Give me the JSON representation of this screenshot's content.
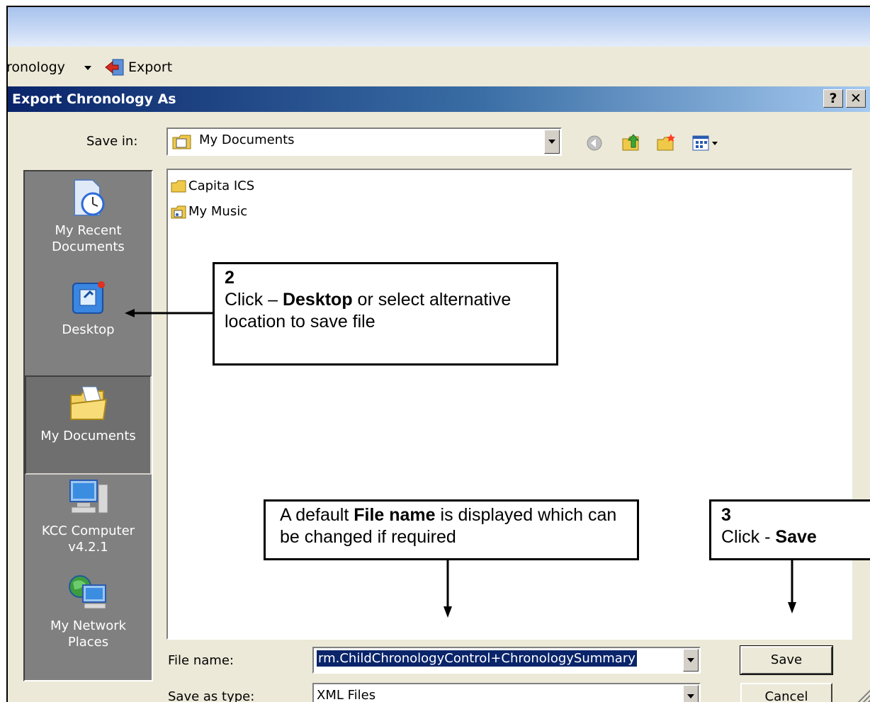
{
  "toolbar": {
    "crumb_text": "ronology",
    "export_label": "Export"
  },
  "dialog": {
    "title": "Export Chronology As",
    "help_button": "?",
    "close_button": "✕",
    "save_in_label": "Save in:",
    "save_in_value": "My Documents",
    "places": [
      {
        "label": "My Recent Documents"
      },
      {
        "label": "Desktop"
      },
      {
        "label": "My Documents"
      },
      {
        "label": "KCC Computer v4.2.1"
      },
      {
        "label": "My Network Places"
      }
    ],
    "files": [
      {
        "name": "Capita ICS"
      },
      {
        "name": "My Music"
      }
    ],
    "file_name_label": "File name:",
    "file_name_value": "rm.ChildChronologyControl+ChronologySummary",
    "save_as_type_label": "Save as type:",
    "save_as_type_value": "XML Files",
    "save_button": "Save",
    "cancel_button": "Cancel"
  },
  "callouts": {
    "c2_num": "2",
    "c2_pre": "Click – ",
    "c2_bold": "Desktop",
    "c2_post": " or select alternative location to save file",
    "cfile_pre": "A default ",
    "cfile_bold": "File name",
    "cfile_post": " is displayed which can be changed if required",
    "c3_num": "3",
    "c3_pre": "Click - ",
    "c3_bold": "Save"
  },
  "colors": {
    "title_start": "#0a246a",
    "dialog_bg": "#ece9d8",
    "places_bg": "#808080",
    "selection": "#0a246a"
  }
}
